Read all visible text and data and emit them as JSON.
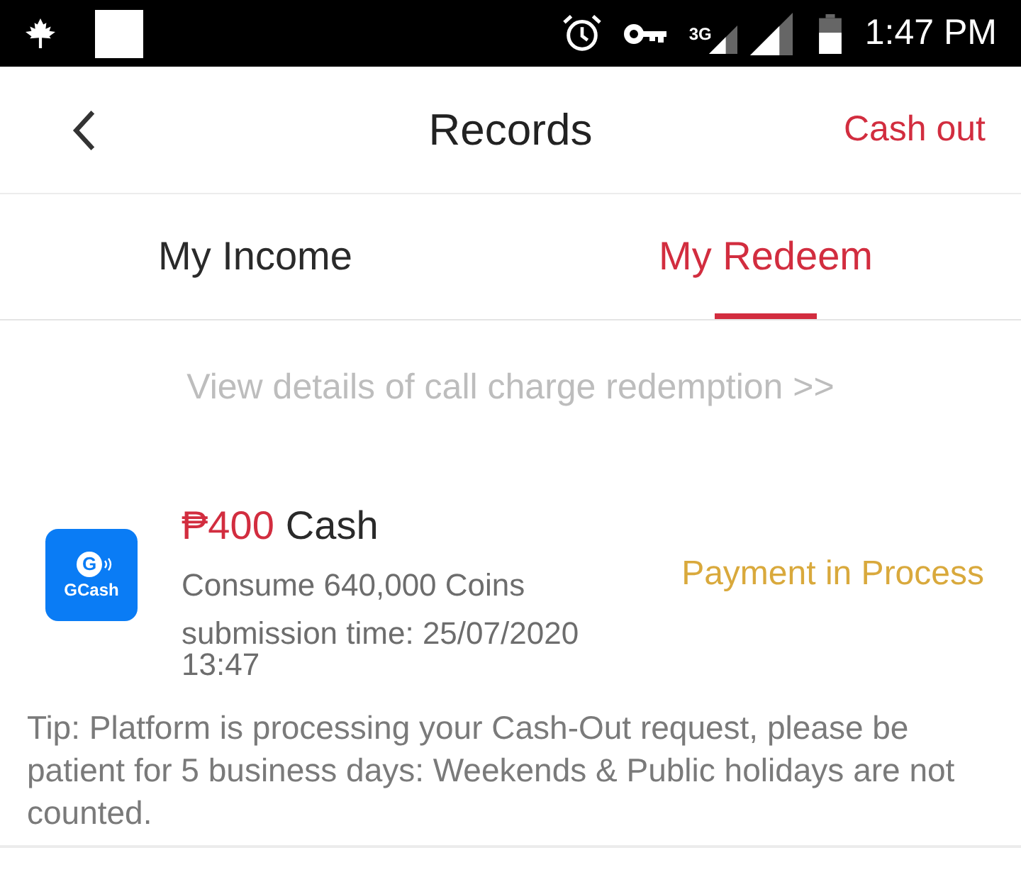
{
  "status_bar": {
    "network": "3G",
    "time": "1:47 PM"
  },
  "header": {
    "title": "Records",
    "action": "Cash out"
  },
  "tabs": [
    {
      "label": "My Income",
      "selected": false
    },
    {
      "label": "My Redeem",
      "selected": true
    }
  ],
  "details_link": "View details of call charge redemption >>",
  "records": [
    {
      "amount": "₱400",
      "title": "Cash",
      "logo_letter": "G",
      "logo_text": "GCash",
      "consume": "Consume 640,000 Coins",
      "submission_time": "submission time: 25/07/2020 13:47",
      "status": "Payment in Process"
    }
  ],
  "tip": "Tip: Platform is processing your Cash-Out request, please be patient for 5 business days: Weekends & Public holidays are not counted."
}
